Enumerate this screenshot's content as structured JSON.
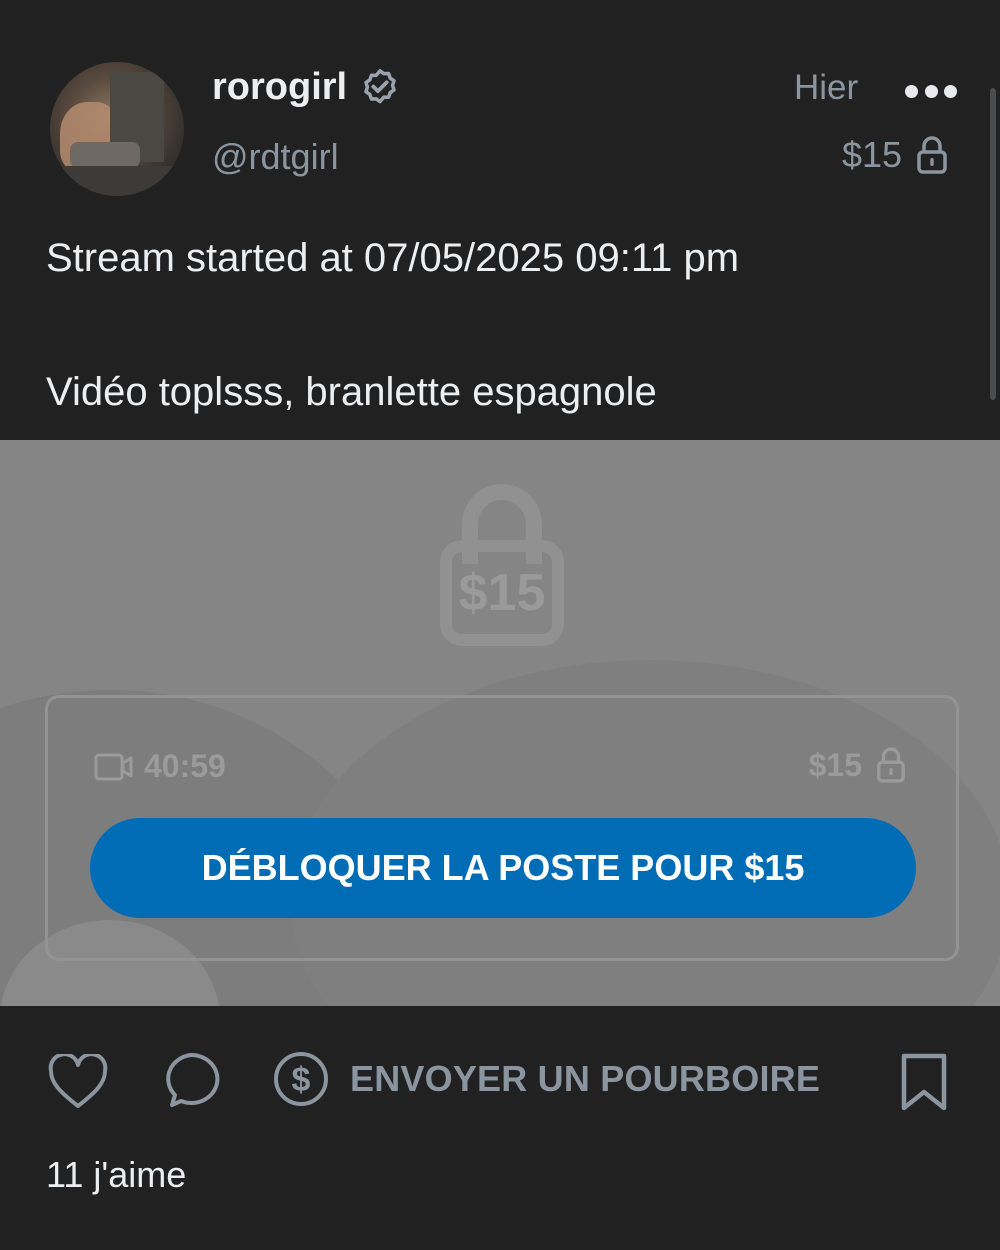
{
  "post": {
    "author": {
      "display_name": "rorogirl",
      "handle": "@rdtgirl",
      "verified_icon": "verified-badge-icon"
    },
    "timestamp": "Hier",
    "price": "$15",
    "text_line1": "Stream started at 07/05/2025 09:11 pm",
    "text_line2": "Vidéo toplsss, branlette espagnole"
  },
  "locked_media": {
    "lock_price": "$15",
    "duration": "40:59",
    "card_price": "$15",
    "unlock_button_label": "DÉBLOQUER LA POSTE POUR $15"
  },
  "actions": {
    "tip_label": "ENVOYER UN POURBOIRE",
    "likes_label": "11 j'aime"
  },
  "colors": {
    "background": "#212122",
    "muted_text": "#8b95a0",
    "primary_button": "#006cb5",
    "locked_overlay": "#858585"
  }
}
